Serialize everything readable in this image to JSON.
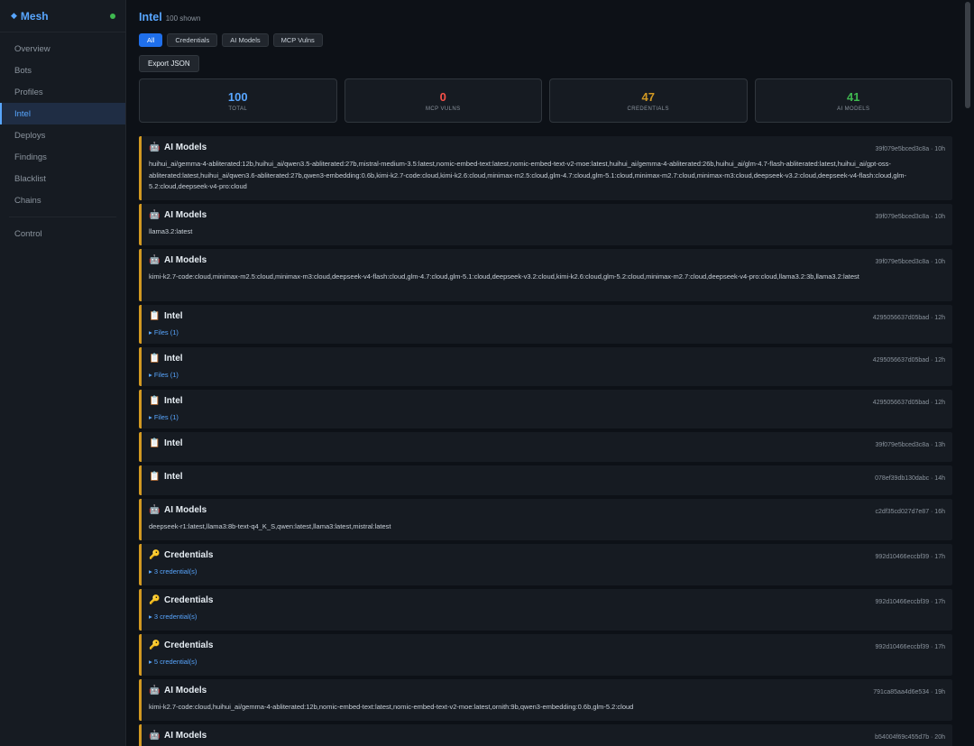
{
  "brand": {
    "name": "Mesh"
  },
  "nav": [
    {
      "label": "Overview"
    },
    {
      "label": "Bots"
    },
    {
      "label": "Profiles"
    },
    {
      "label": "Intel"
    },
    {
      "label": "Deploys"
    },
    {
      "label": "Findings"
    },
    {
      "label": "Blacklist"
    },
    {
      "label": "Chains"
    },
    {
      "label": "Control"
    }
  ],
  "header": {
    "title": "Intel",
    "subtitle": "100 shown"
  },
  "filters": [
    {
      "label": "All",
      "active": true
    },
    {
      "label": "Credentials"
    },
    {
      "label": "AI Models"
    },
    {
      "label": "MCP Vulns"
    }
  ],
  "export_label": "Export JSON",
  "stats": [
    {
      "value": "100",
      "label": "TOTAL",
      "color": "#58a6ff"
    },
    {
      "value": "0",
      "label": "MCP VULNS",
      "color": "#f85149"
    },
    {
      "value": "47",
      "label": "CREDENTIALS",
      "color": "#d29922"
    },
    {
      "value": "41",
      "label": "AI MODELS",
      "color": "#3fb950"
    }
  ],
  "feed": [
    {
      "icon": "🤖",
      "icon_name": "robot-icon",
      "title": "AI Models",
      "meta": "39f079e5bced3c8a · 10h",
      "body": "huihui_ai/gemma-4-abliterated:12b,huihui_ai/qwen3.5-abliterated:27b,mistral-medium-3.5:latest,nomic-embed-text:latest,nomic-embed-text-v2-moe:latest,huihui_ai/gemma-4-abliterated:26b,huihui_ai/glm-4.7-flash-abliterated:latest,huihui_ai/gpt-oss-abliterated:latest,huihui_ai/qwen3.6-abliterated:27b,qwen3-embedding:0.6b,kimi-k2.7-code:cloud,kimi-k2.6:cloud,minimax-m2.5:cloud,glm-4.7:cloud,glm-5.1:cloud,minimax-m2.7:cloud,minimax-m3:cloud,deepseek-v3.2:cloud,deepseek-v4-flash:cloud,glm-5.2:cloud,deepseek-v4-pro:cloud"
    },
    {
      "icon": "🤖",
      "icon_name": "robot-icon",
      "title": "AI Models",
      "meta": "39f079e5bced3c8a · 10h",
      "body": "llama3.2:latest"
    },
    {
      "icon": "🤖",
      "icon_name": "robot-icon",
      "title": "AI Models",
      "meta": "39f079e5bced3c8a · 10h",
      "body": "kimi-k2.7-code:cloud,minimax-m2.5:cloud,minimax-m3:cloud,deepseek-v4-flash:cloud,glm-4.7:cloud,glm-5.1:cloud,deepseek-v3.2:cloud,kimi-k2.6:cloud,glm-5.2:cloud,minimax-m2.7:cloud,deepseek-v4-pro:cloud,llama3.2:3b,llama3.2:latest"
    },
    {
      "icon": "📋",
      "icon_name": "clipboard-icon",
      "title": "Intel",
      "meta": "4295056637d05bad · 12h",
      "link": "▸ Files (1)"
    },
    {
      "icon": "📋",
      "icon_name": "clipboard-icon",
      "title": "Intel",
      "meta": "4295056637d05bad · 12h",
      "link": "▸ Files (1)"
    },
    {
      "icon": "📋",
      "icon_name": "clipboard-icon",
      "title": "Intel",
      "meta": "4295056637d05bad · 12h",
      "link": "▸ Files (1)"
    },
    {
      "icon": "📋",
      "icon_name": "clipboard-icon",
      "title": "Intel",
      "meta": "39f079e5bced3c8a · 13h"
    },
    {
      "icon": "📋",
      "icon_name": "clipboard-icon",
      "title": "Intel",
      "meta": "078ef39db130dabc · 14h"
    },
    {
      "icon": "🤖",
      "icon_name": "robot-icon",
      "title": "AI Models",
      "meta": "c2df35cd027d7e87 · 16h",
      "body": "deepseek-r1:latest,llama3:8b-text-q4_K_S,qwen:latest,llama3:latest,mistral:latest"
    },
    {
      "icon": "🔑",
      "icon_name": "key-icon",
      "title": "Credentials",
      "meta": "992d10466eccbf39 · 17h",
      "link": "▸ 3 credential(s)"
    },
    {
      "icon": "🔑",
      "icon_name": "key-icon",
      "title": "Credentials",
      "meta": "992d10466eccbf39 · 17h",
      "link": "▸ 3 credential(s)"
    },
    {
      "icon": "🔑",
      "icon_name": "key-icon",
      "title": "Credentials",
      "meta": "992d10466eccbf39 · 17h",
      "link": "▸ 5 credential(s)"
    },
    {
      "icon": "🤖",
      "icon_name": "robot-icon",
      "title": "AI Models",
      "meta": "791ca85aa4d6e534 · 19h",
      "body": "kimi-k2.7-code:cloud,huihui_ai/gemma-4-abliterated:12b,nomic-embed-text:latest,nomic-embed-text-v2-moe:latest,ornith:9b,qwen3-embedding:0.6b,glm-5.2:cloud"
    },
    {
      "icon": "🤖",
      "icon_name": "robot-icon",
      "title": "AI Models",
      "meta": "b54004f69c455d7b · 20h"
    }
  ]
}
